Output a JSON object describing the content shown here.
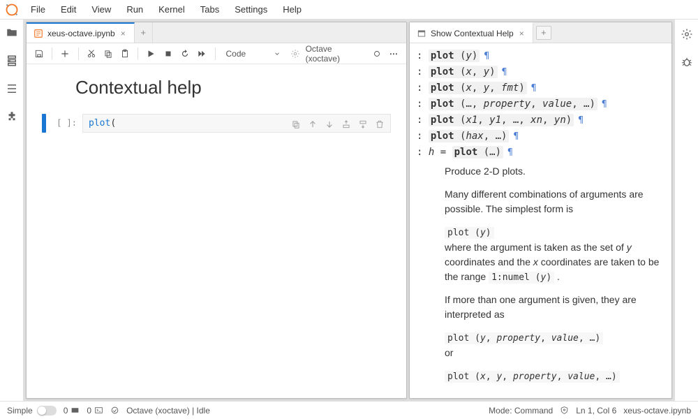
{
  "menu": {
    "items": [
      "File",
      "Edit",
      "View",
      "Run",
      "Kernel",
      "Tabs",
      "Settings",
      "Help"
    ]
  },
  "leftbar_icons": [
    "folder-icon",
    "running-icon",
    "toc-icon",
    "extension-icon"
  ],
  "rightbar_icons": [
    "gear-icon",
    "bug-icon"
  ],
  "notebook_tab": {
    "label": "xeus-octave.ipynb"
  },
  "help_tab": {
    "label": "Show Contextual Help"
  },
  "toolbar": {
    "cell_type": "Code",
    "kernel": "Octave (xoctave)"
  },
  "notebook": {
    "markdown_title": "Contextual help",
    "prompt": "[ ]:",
    "code_keyword": "plot",
    "code_rest": "("
  },
  "help": {
    "signatures": [
      {
        "prefix": ": ",
        "fn": "plot",
        "args": "(<i>y</i>)"
      },
      {
        "prefix": ": ",
        "fn": "plot",
        "args": "(<i>x</i>, <i>y</i>)"
      },
      {
        "prefix": ": ",
        "fn": "plot",
        "args": "(<i>x</i>, <i>y</i>, <i>fmt</i>)"
      },
      {
        "prefix": ": ",
        "fn": "plot",
        "args": "(…, <i>property</i>, <i>value</i>, …)"
      },
      {
        "prefix": ": ",
        "fn": "plot",
        "args": "(<i>x1</i>, <i>y1</i>, …, <i>xn</i>, <i>yn</i>)"
      },
      {
        "prefix": ": ",
        "fn": "plot",
        "args": "(<i>hax</i>, …)"
      },
      {
        "prefix": ": <i>h</i> = ",
        "fn": "plot",
        "args": "(…)"
      }
    ],
    "para1": "Produce 2-D plots.",
    "para2": "Many different combinations of arguments are possible. The simplest form is",
    "code1": "plot (y)",
    "para3_a": "where the argument is taken as the set of ",
    "para3_b": " coordinates and the ",
    "para3_c": " coordinates are taken to be the range ",
    "code2": "1:numel (y)",
    "para4": "If more than one argument is given, they are interpreted as",
    "code3": "plot (y, property, value, …)",
    "or": "or",
    "code4": "plot (x, y, property, value, …)"
  },
  "status": {
    "simple": "Simple",
    "count1": "0",
    "count2": "0",
    "kernel_status": "Octave (xoctave) | Idle",
    "mode": "Mode: Command",
    "cursor": "Ln 1, Col 6",
    "file": "xeus-octave.ipynb"
  }
}
